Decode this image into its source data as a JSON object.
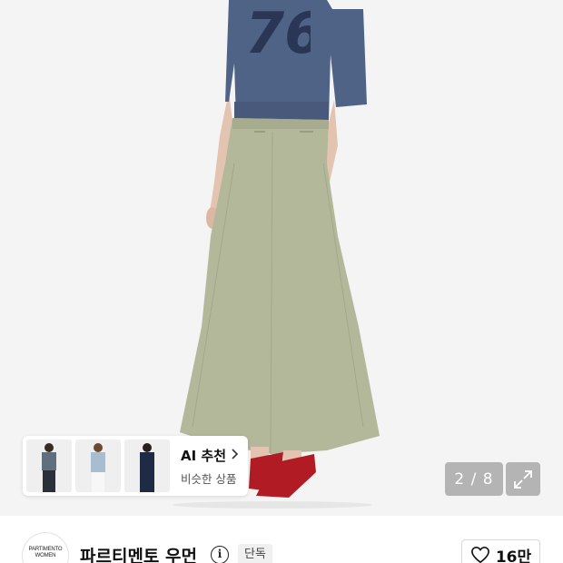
{
  "product_image": {
    "jersey_number": "76"
  },
  "ai_recommend": {
    "title": "AI 추천",
    "chevron_icon": "chevron-right-icon",
    "subtitle": "비슷한 상품",
    "thumbnails": [
      {
        "top_color": "#5f6f7e",
        "bottom_color": "#2a2f3a"
      },
      {
        "top_color": "#a9bdd1",
        "bottom_color": "#f2f2f2"
      },
      {
        "top_color": "#1f2a44",
        "bottom_color": "#1f2a44"
      }
    ]
  },
  "gallery": {
    "page_indicator": "2 / 8",
    "expand_icon": "expand-icon"
  },
  "brand": {
    "logo_line1": "PARTIMENTO",
    "logo_line2": "WOMEN",
    "name": "파르티멘토 우먼",
    "info_icon": "info-icon",
    "badge": "단독",
    "like_icon": "heart-outline-icon",
    "like_count": "16만"
  },
  "colors": {
    "skirt": "#b3b89b",
    "top": "#4f6387",
    "shoes": "#b11c24",
    "overlay": "rgba(140,140,140,0.62)"
  }
}
